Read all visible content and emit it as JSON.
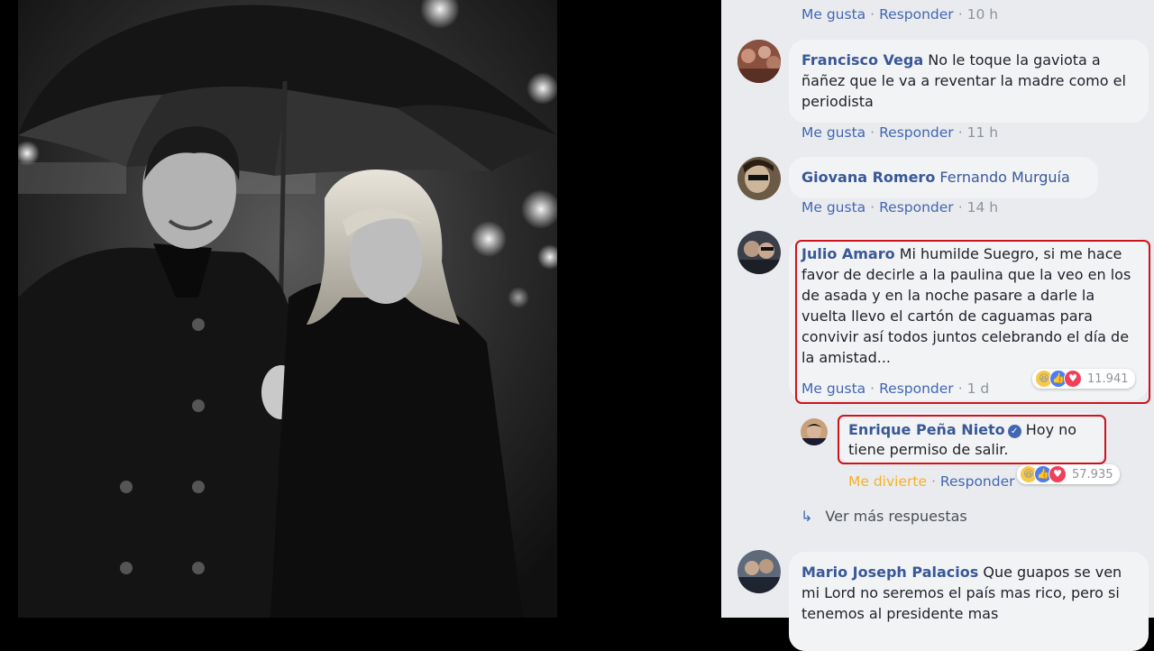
{
  "comments": [
    {
      "actions": {
        "like": "Me gusta",
        "reply": "Responder",
        "time": "10 h"
      }
    },
    {
      "author": "Francisco Vega",
      "text": "No le toque la gaviota a ñañez que le va a reventar la madre como el periodista",
      "actions": {
        "like": "Me gusta",
        "reply": "Responder",
        "time": "11 h"
      }
    },
    {
      "author": "Giovana Romero",
      "text": "Fernando Murguía",
      "actions": {
        "like": "Me gusta",
        "reply": "Responder",
        "time": "14 h"
      }
    },
    {
      "author": "Julio Amaro",
      "text": "Mi humilde Suegro, si me hace favor de decirle a la paulina que la veo en los de asada y en la noche pasare a darle la vuelta llevo el cartón de caguamas para convivir así todos juntos celebrando el día de la amistad...",
      "reactions": "11.941",
      "actions": {
        "like": "Me gusta",
        "reply": "Responder",
        "time": "1 d"
      }
    },
    {
      "author": "Enrique Peña Nieto",
      "verified": true,
      "text": "Hoy no tiene permiso de salir.",
      "reactions": "57.935",
      "actions": {
        "like": "Me divierte",
        "reply": "Responder"
      }
    },
    {
      "author": "Mario Joseph Palacios",
      "text": "Que guapos se ven mi Lord no seremos el país mas rico, pero si tenemos al presidente mas"
    }
  ],
  "more_replies": "Ver más respuestas",
  "colors": {
    "author": "#385898",
    "link": "#4267b2",
    "highlight": "#d0121b",
    "pane_bg": "#e9ebee",
    "bubble_bg": "#f2f3f5"
  },
  "icons": [
    "verified-badge-icon",
    "reply-arrow-icon",
    "haha-reaction-icon",
    "like-reaction-icon",
    "love-reaction-icon"
  ]
}
